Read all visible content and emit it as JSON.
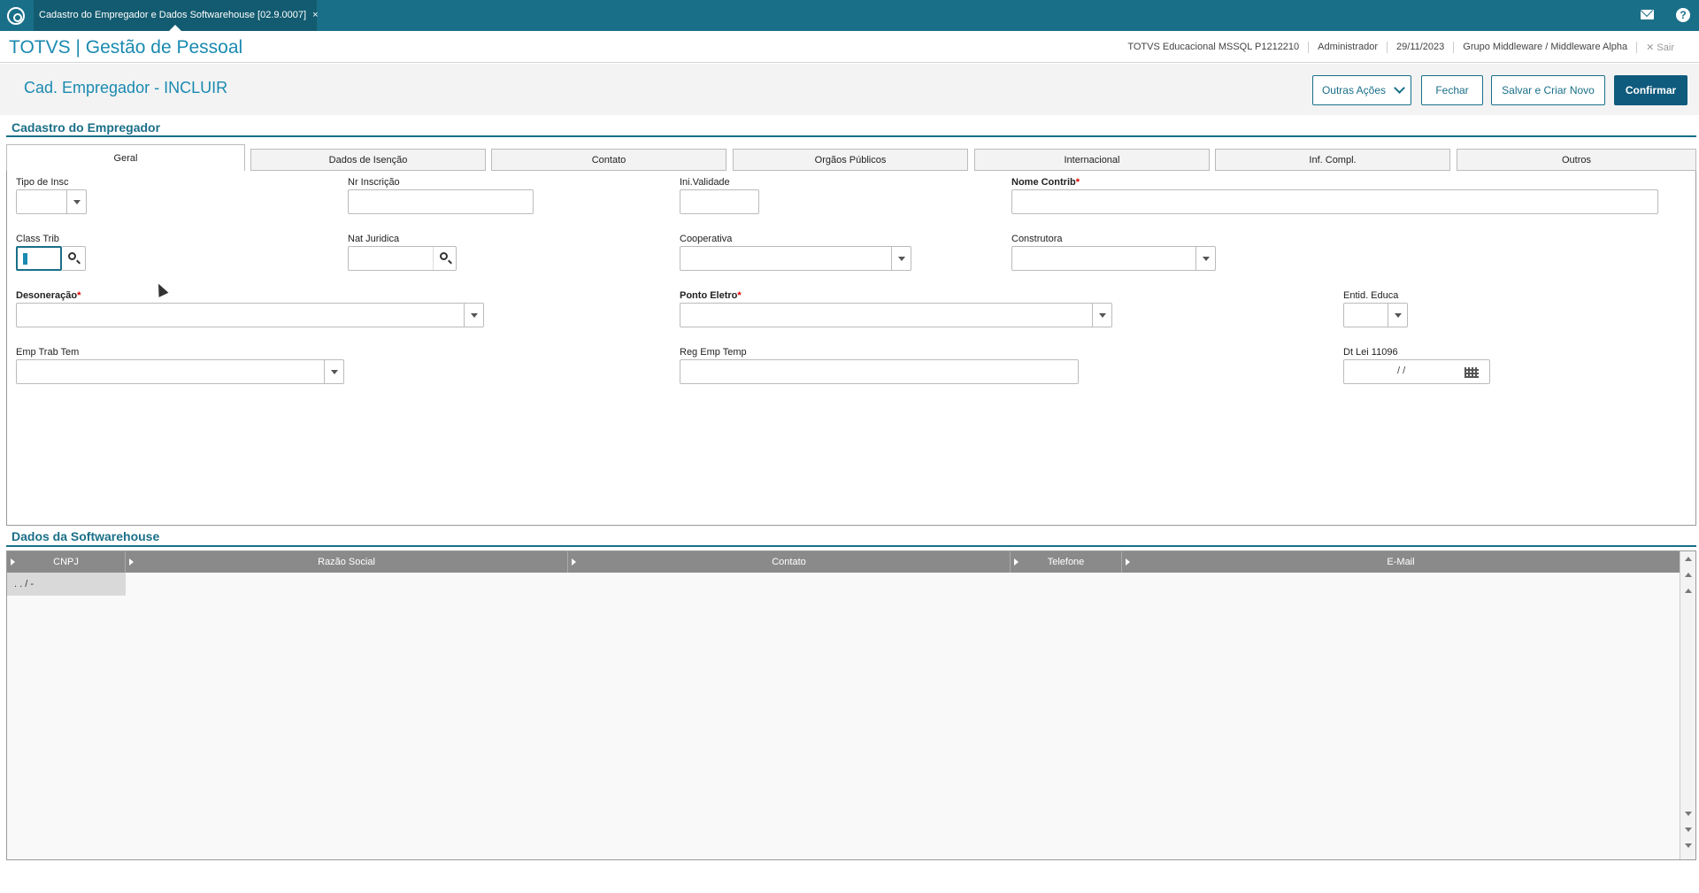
{
  "topbar": {
    "tab_title": "Cadastro do Empregador e Dados Softwarehouse [02.9.0007]",
    "tab_close": "×",
    "help": "?"
  },
  "header": {
    "brand": "TOTVS | Gestão de Pessoal",
    "environment": "TOTVS Educacional MSSQL P1212210",
    "user": "Administrador",
    "date": "29/11/2023",
    "group": "Grupo Middleware / Middleware Alpha",
    "logout": "✕  Sair"
  },
  "page": {
    "title": "Cad. Empregador - INCLUIR",
    "buttons": {
      "outras": "Outras Ações",
      "fechar": "Fechar",
      "salvar": "Salvar e Criar Novo",
      "confirmar": "Confirmar"
    }
  },
  "section_empregador": {
    "title": "Cadastro do Empregador",
    "tabs": [
      "Geral",
      "Dados de Isenção",
      "Contato",
      "Orgãos Públicos",
      "Internacional",
      "Inf. Compl.",
      "Outros"
    ],
    "fields": {
      "tipo_insc": "Tipo de Insc",
      "nr_inscricao": "Nr Inscrição",
      "ini_validade": "Ini.Validade",
      "nome_contrib": "Nome Contrib",
      "class_trib": "Class Trib",
      "nat_juridica": "Nat Juridica",
      "cooperativa": "Cooperativa",
      "construtora": "Construtora",
      "desoneracao": "Desoneração",
      "ponto_eletro": "Ponto Eletro",
      "entid_educa": "Entid. Educa",
      "emp_trab_tem": "Emp Trab Tem",
      "reg_emp_temp": "Reg Emp Temp",
      "dt_lei": "Dt Lei 11096",
      "dt_lei_value": "/ /"
    }
  },
  "section_softwarehouse": {
    "title": "Dados da Softwarehouse",
    "columns": [
      "CNPJ",
      "Razão Social",
      "Contato",
      "Telefone",
      "E-Mail"
    ],
    "rows": [
      {
        "cnpj": ". . /  -"
      }
    ]
  }
}
